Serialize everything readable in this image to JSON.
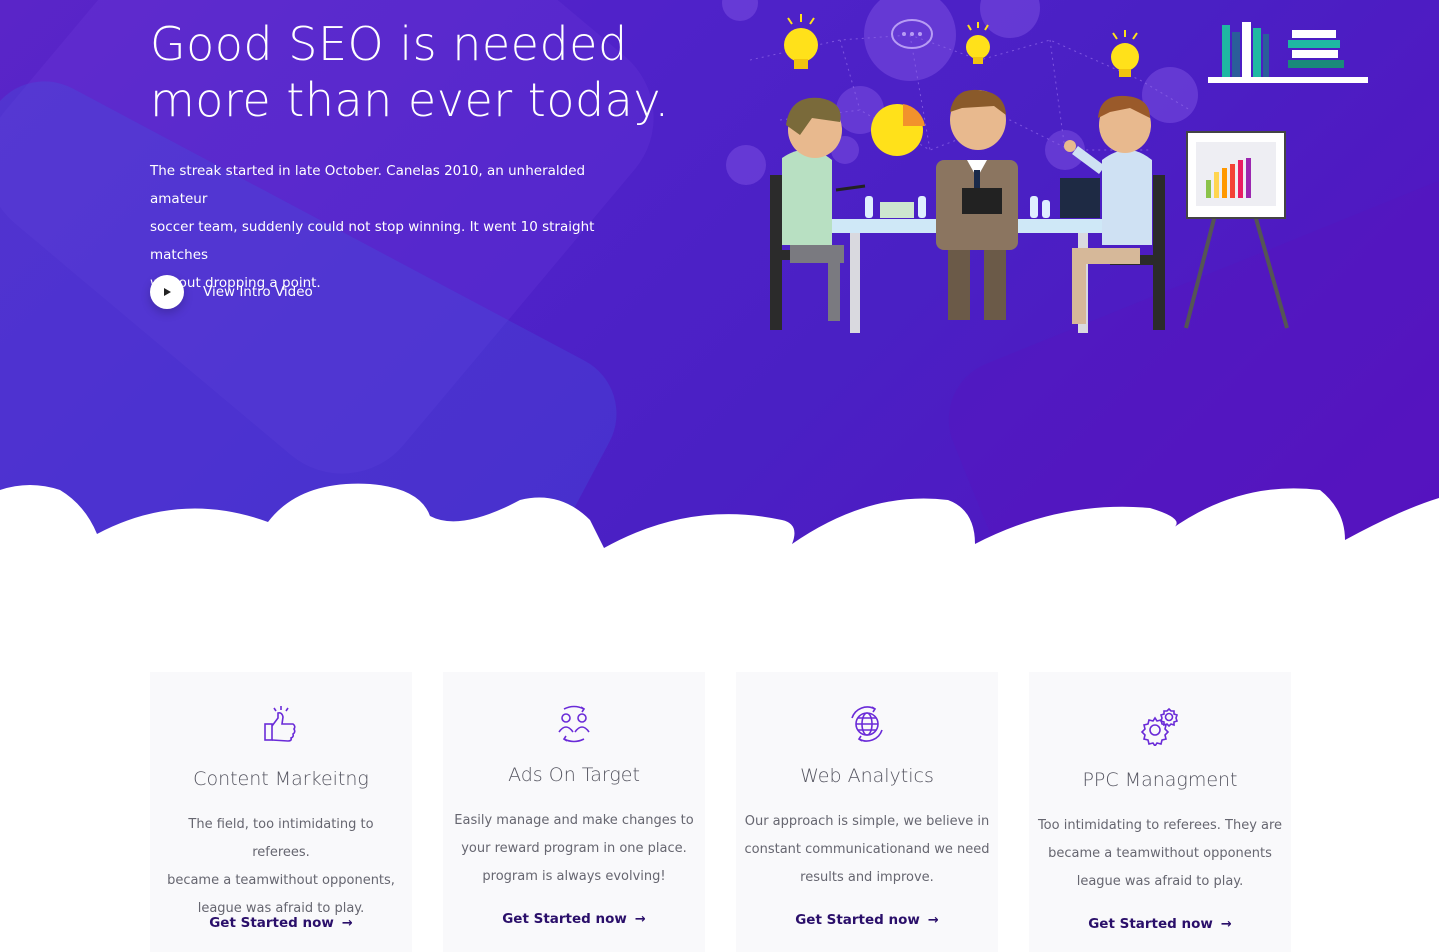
{
  "hero": {
    "title_line1": "Good SEO is needed",
    "title_line2": "more than ever today.",
    "desc_line1": "The streak started in late October. Canelas 2010, an unheralded amateur",
    "desc_line2": "soccer team, suddenly could not stop winning. It went 10 straight matches",
    "desc_line3": "without dropping a point.",
    "video_label": "View Intro Video",
    "play_icon": "play-icon",
    "colors": {
      "gradient_start": "#5a25c8",
      "gradient_end": "#5512c0",
      "accent": "#8b3ff0"
    }
  },
  "cards": [
    {
      "icon": "thumbs-up-icon",
      "title": "Content Markeitng",
      "lines": [
        "The field, too intimidating to referees.",
        "became a teamwithout opponents,",
        "league was afraid to play."
      ],
      "cta": "Get Started now"
    },
    {
      "icon": "users-exchange-icon",
      "title": "Ads On Target",
      "lines": [
        "Easily manage and make changes to",
        "your reward program in one place.",
        "program is always evolving!"
      ],
      "cta": "Get Started now"
    },
    {
      "icon": "globe-icon",
      "title": "Web Analytics",
      "lines": [
        "Our approach is simple, we believe in",
        "constant communicationand we need",
        "results and improve."
      ],
      "cta": "Get Started now"
    },
    {
      "icon": "gears-icon",
      "title": "PPC Managment",
      "lines": [
        "Too intimidating to referees. They are",
        "became a teamwithout opponents",
        "league was afraid to play."
      ],
      "cta": "Get Started now"
    }
  ],
  "colors": {
    "card_bg": "#f9f9fb",
    "icon_purple": "#6a2bd8",
    "cta_dark": "#2a0f6a"
  }
}
